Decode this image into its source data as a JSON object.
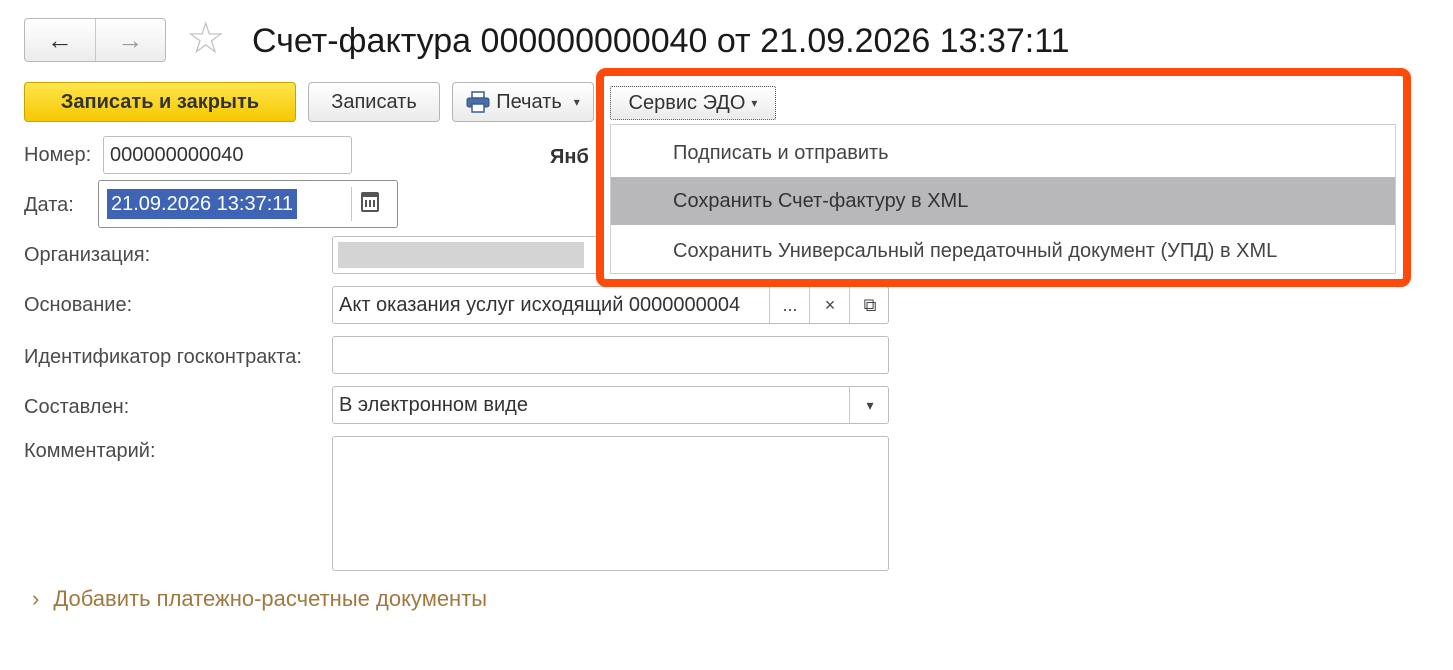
{
  "header": {
    "title": "Счет-фактура 000000000040 от 21.09.2026 13:37:11",
    "back_icon": "←",
    "forward_icon": "→",
    "favorite_icon": "☆"
  },
  "toolbar": {
    "save_close_label": "Записать и закрыть",
    "save_label": "Записать",
    "print_label": "Печать",
    "edo_label": "Сервис ЭДО",
    "caret": "▾"
  },
  "form": {
    "number_label": "Номер:",
    "number_value": "000000000040",
    "date_label": "Дата:",
    "date_value": "21.09.2026 13:37:11",
    "partial_text": "Янб",
    "org_label": "Организация:",
    "basis_label": "Основание:",
    "basis_value": "Акт оказания услуг исходящий 0000000004",
    "basis_more": "...",
    "basis_clear": "×",
    "basis_open": "⧉",
    "contract_label": "Идентификатор госконтракта:",
    "contract_value": "",
    "composed_label": "Составлен:",
    "composed_value": "В электронном виде",
    "composed_caret": "▾",
    "comment_label": "Комментарий:",
    "comment_value": ""
  },
  "footer": {
    "chevron": "›",
    "add_docs_label": "Добавить платежно-расчетные документы"
  },
  "edo_menu": {
    "items": [
      "Подписать и отправить",
      "Сохранить Счет-фактуру в XML",
      "Сохранить Универсальный передаточный документ (УПД) в XML"
    ]
  },
  "colors": {
    "accent_button": "#f5c800",
    "highlight_frame": "#ff4a0c",
    "selection": "#3f64b6",
    "link": "#a07840"
  }
}
